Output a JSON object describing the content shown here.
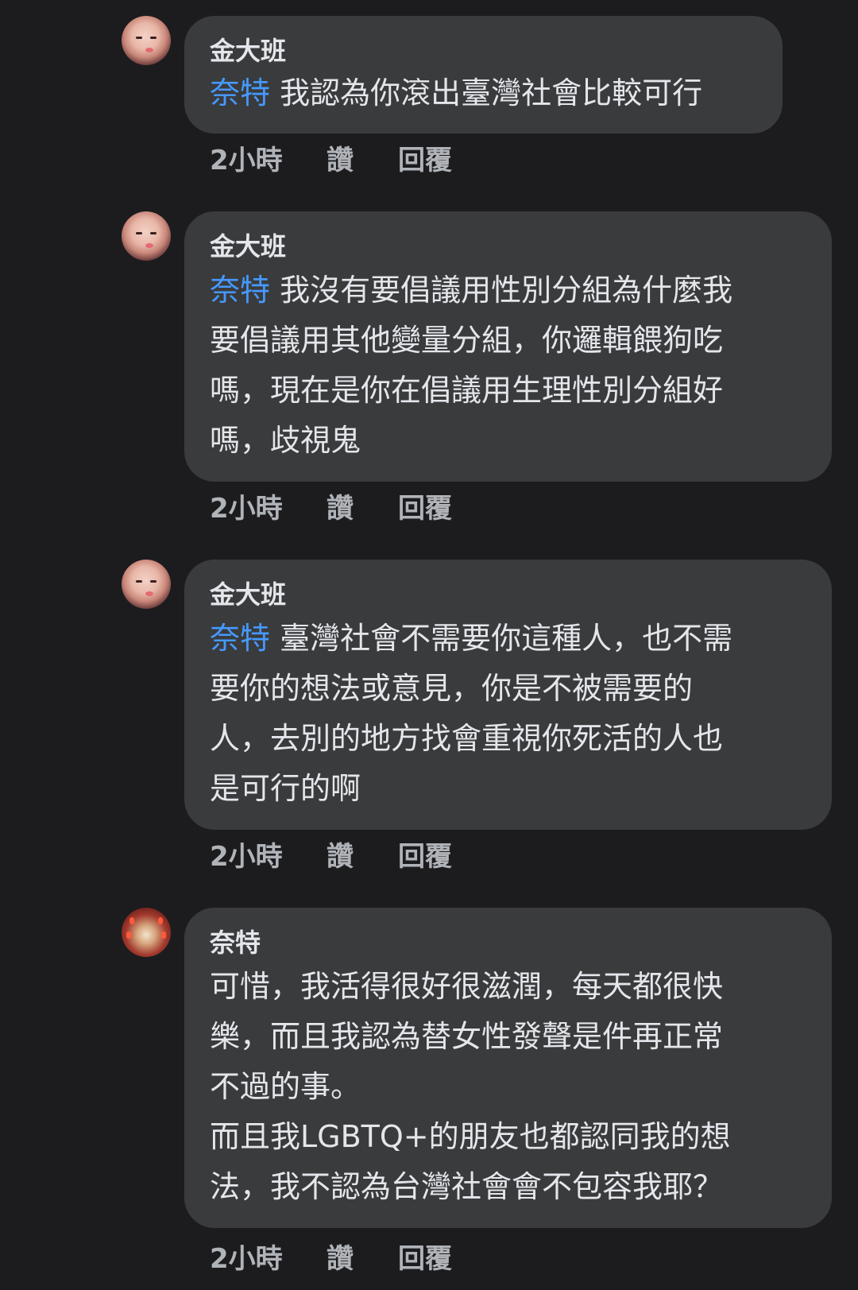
{
  "comments": [
    {
      "author": "金大班",
      "mention": "奈特",
      "text": " 我認為你滾出臺灣社會比較可行",
      "time": "2小時",
      "like": "讚",
      "reply": "回覆"
    },
    {
      "author": "金大班",
      "mention": "奈特",
      "text": " 我沒有要倡議用性別分組為什麼我\n要倡議用其他變量分組，你邏輯餵狗吃\n嗎，現在是你在倡議用生理性別分組好\n嗎，歧視鬼",
      "time": "2小時",
      "like": "讚",
      "reply": "回覆"
    },
    {
      "author": "金大班",
      "mention": "奈特",
      "text": " 臺灣社會不需要你這種人，也不需\n要你的想法或意見，你是不被需要的\n人，去別的地方找會重視你死活的人也\n是可行的啊",
      "time": "2小時",
      "like": "讚",
      "reply": "回覆"
    },
    {
      "author": "奈特",
      "mention": "",
      "text": "可惜，我活得很好很滋潤，每天都很快\n樂，而且我認為替女性發聲是件再正常\n不過的事。\n而且我LGBTQ+的朋友也都認同我的想\n法，我不認為台灣社會會不包容我耶？",
      "time": "2小時",
      "like": "讚",
      "reply": "回覆"
    }
  ],
  "colors": {
    "background": "#1c1c1e",
    "bubble": "#3a3b3c",
    "mention": "#4599ff",
    "meta": "#b0b3b8"
  }
}
